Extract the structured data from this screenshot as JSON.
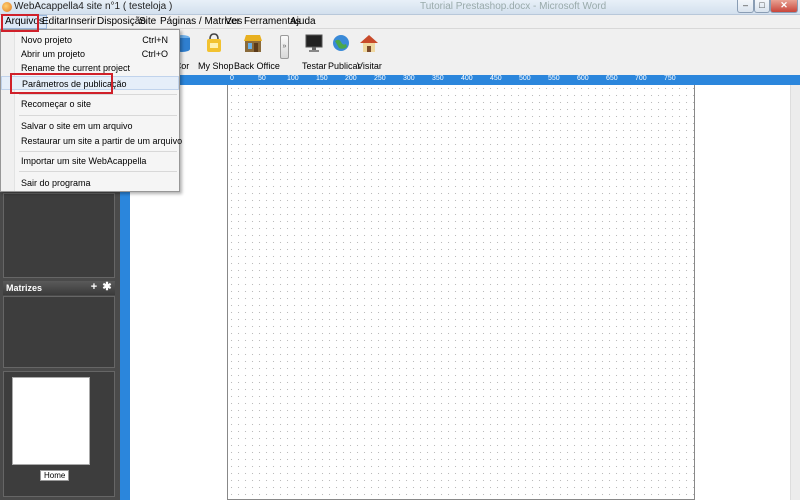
{
  "window": {
    "title": "WebAcappella4 site n°1 ( testeloja )",
    "ghost_title": "Tutorial Prestashop.docx - Microsoft Word",
    "minimize_glyph": "–",
    "maximize_glyph": "□",
    "close_glyph": "✕"
  },
  "menubar": {
    "items": [
      "Arquivos",
      "Editar",
      "Inserir",
      "Disposição",
      "Site",
      "Páginas / Matrizes",
      "Ver",
      "Ferramentas",
      "Ajuda"
    ]
  },
  "toolbar": {
    "buttons": [
      {
        "label": "Cor",
        "icon": "color-cylinder-icon"
      },
      {
        "label": "My Shop",
        "icon": "shopping-bag-icon"
      },
      {
        "label": "Back Office",
        "icon": "storefront-icon"
      },
      {
        "label": "Testar",
        "icon": "monitor-icon"
      },
      {
        "label": "Publicar",
        "icon": "globe-icon"
      },
      {
        "label": "Visitar",
        "icon": "house-icon"
      }
    ],
    "more_glyph": "»"
  },
  "ruler_labels": [
    "0",
    "50",
    "100",
    "150",
    "200",
    "250",
    "300",
    "350",
    "400",
    "450",
    "500",
    "550",
    "600",
    "650",
    "700",
    "750"
  ],
  "left_panel": {
    "matrizes_title": "Matrizes",
    "add_glyph": "+",
    "settings_glyph": "✱",
    "page_label": "Home"
  },
  "file_menu": {
    "items": [
      {
        "label": "Novo projeto",
        "shortcut": "Ctrl+N"
      },
      {
        "label": "Abrir um projeto",
        "shortcut": "Ctrl+O"
      },
      {
        "label": "Rename the current project",
        "shortcut": ""
      },
      {
        "label": "Parâmetros de publicação",
        "shortcut": ""
      },
      {
        "label": "Recomeçar o site",
        "shortcut": ""
      },
      {
        "label": "Salvar o site em um arquivo",
        "shortcut": ""
      },
      {
        "label": "Restaurar um site a partir de um arquivo",
        "shortcut": ""
      },
      {
        "label": "Importar um site WebAcappella",
        "shortcut": ""
      },
      {
        "label": "Sair do programa",
        "shortcut": ""
      }
    ]
  },
  "colors": {
    "ruler_blue": "#2b86dc",
    "highlight_red": "#d0202a",
    "panel_dark": "#4a4a4a"
  }
}
